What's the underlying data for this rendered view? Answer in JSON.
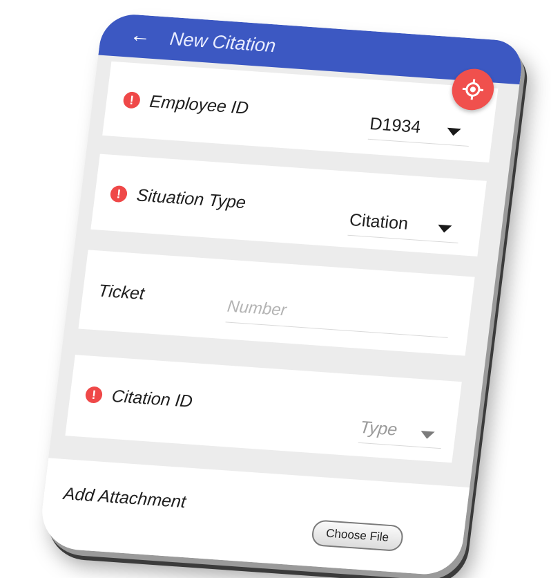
{
  "appbar": {
    "back_icon": "arrow-back-icon",
    "title": "New Citation"
  },
  "fab": {
    "icon": "location-target-icon",
    "color": "#f0504d"
  },
  "theme": {
    "primary": "#3c58c2",
    "error": "#ef4848"
  },
  "form": {
    "employee": {
      "label": "Employee ID",
      "value": "D1934",
      "required": true
    },
    "situation": {
      "label": "Situation Type",
      "value": "Citation",
      "required": true
    },
    "ticket": {
      "label": "Ticket",
      "placeholder": "Number"
    },
    "citation": {
      "label": "Citation ID",
      "placeholder": "Type",
      "required": true
    },
    "attachment": {
      "label": "Add Attachment",
      "button_label": "Choose File"
    }
  }
}
